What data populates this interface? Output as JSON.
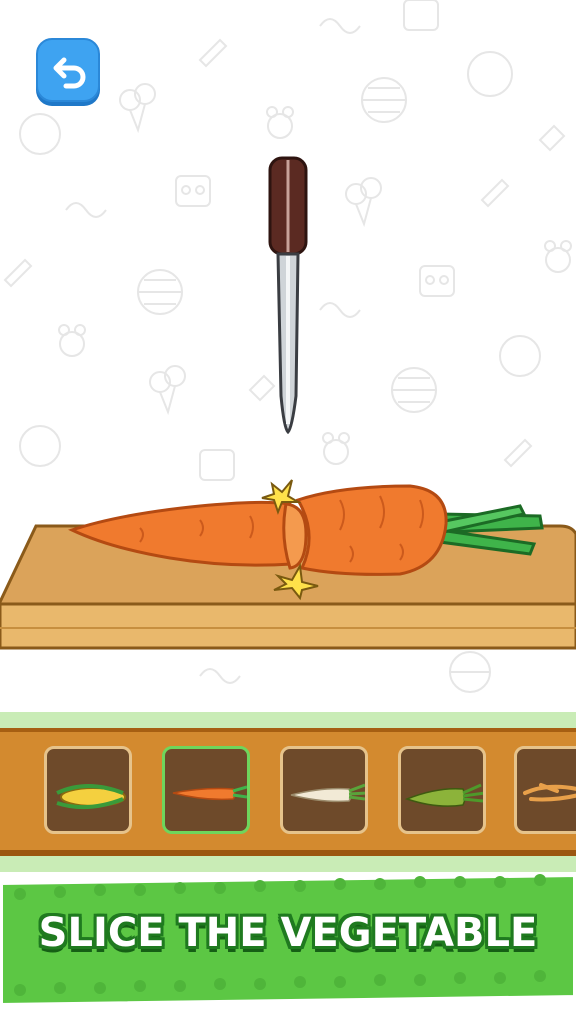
{
  "banner": {
    "text": "SLICE THE VEGETABLE"
  },
  "icons": {
    "back": "undo-arrow-icon"
  },
  "colors": {
    "carrot": "#f07a2e",
    "board": "#dba35a",
    "tray": "#d38a2f",
    "banner": "#5cc744",
    "selected": "#6ed65c"
  },
  "vegetables": [
    {
      "name": "corn",
      "selected": false
    },
    {
      "name": "carrot",
      "selected": true
    },
    {
      "name": "parsnip",
      "selected": false
    },
    {
      "name": "cucumber",
      "selected": false
    },
    {
      "name": "ginseng",
      "selected": false
    }
  ]
}
